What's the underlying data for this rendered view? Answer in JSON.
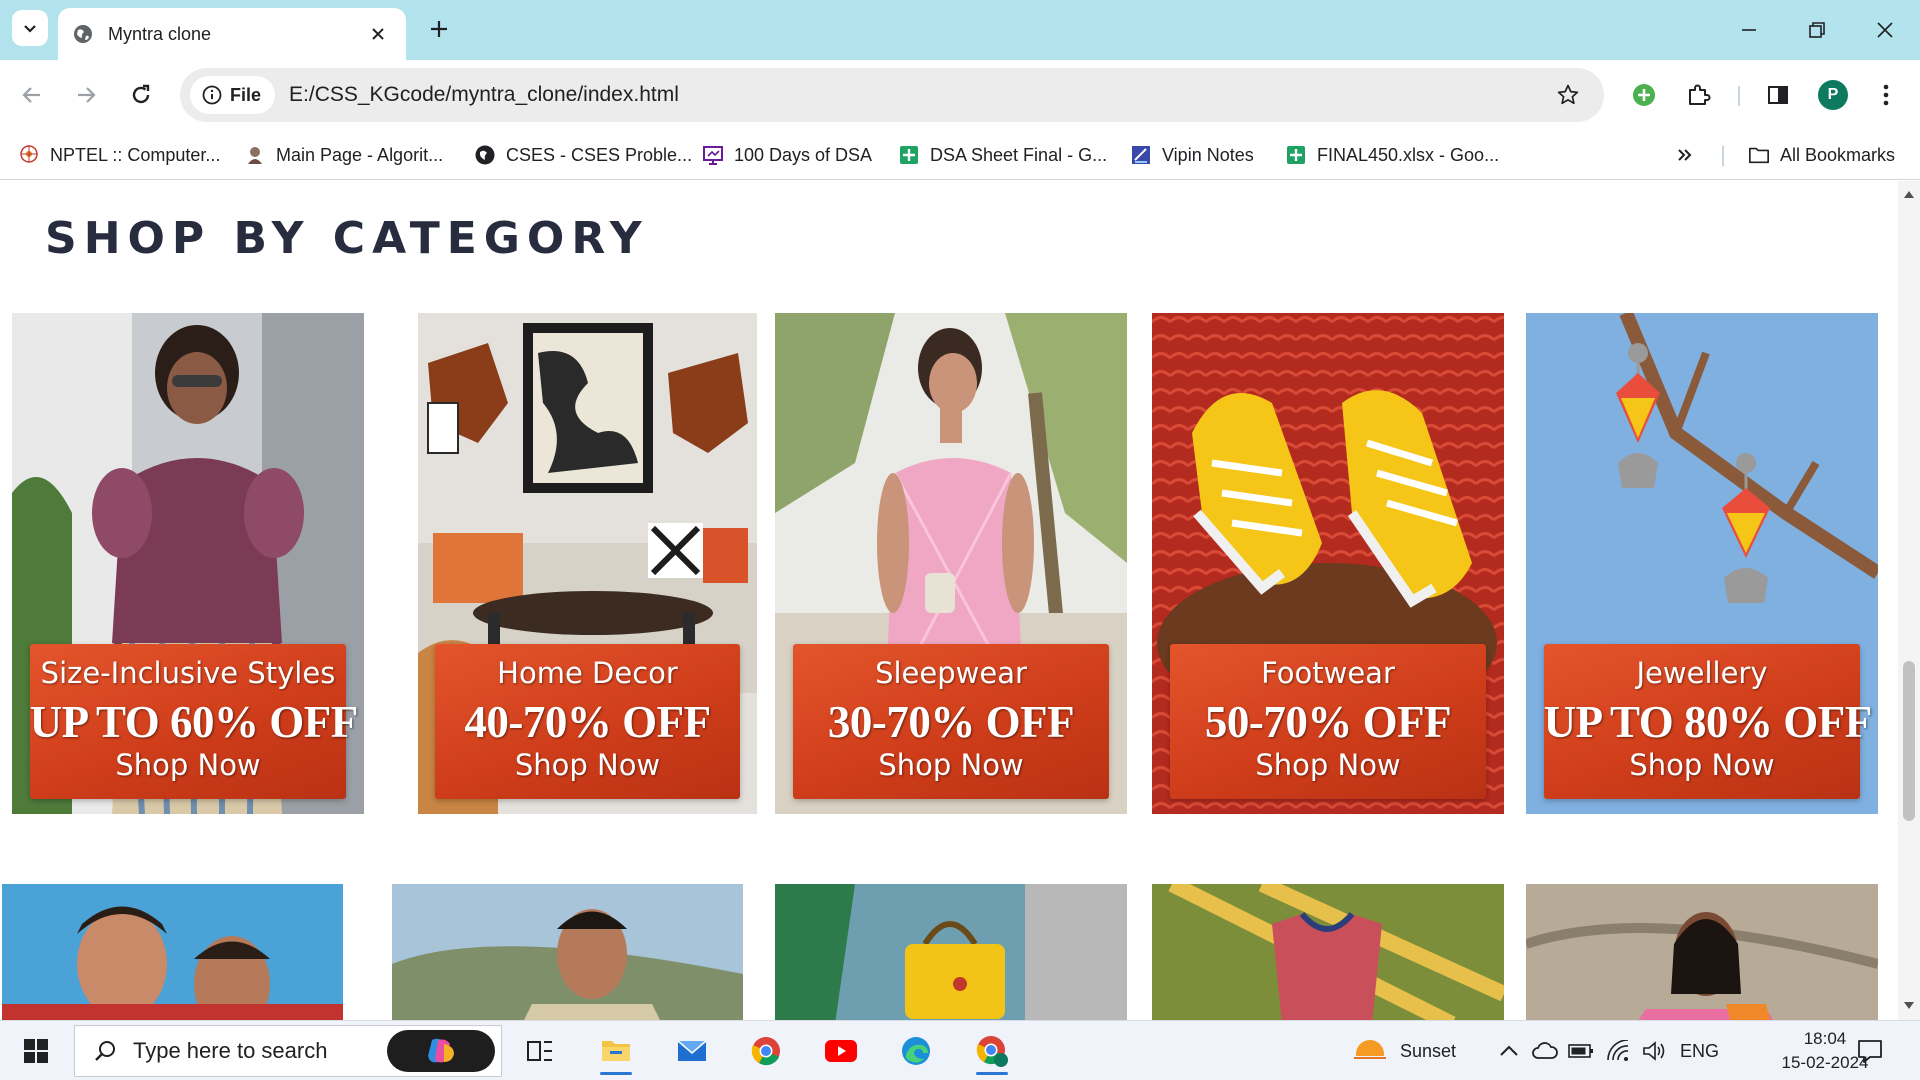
{
  "browser": {
    "tab_title": "Myntra clone",
    "site_chip_label": "File",
    "url": "E:/CSS_KGcode/myntra_clone/index.html",
    "avatar_initial": "P",
    "bookmarks": [
      {
        "label": "NPTEL :: Computer...",
        "icon": "nptel-icon"
      },
      {
        "label": "Main Page - Algorit...",
        "icon": "algorithmica-icon"
      },
      {
        "label": "CSES - CSES Proble...",
        "icon": "cses-icon"
      },
      {
        "label": "100 Days of DSA",
        "icon": "slides-icon"
      },
      {
        "label": "DSA Sheet Final - G...",
        "icon": "sheets-icon"
      },
      {
        "label": "Vipin Notes",
        "icon": "notes-icon"
      },
      {
        "label": "FINAL450.xlsx - Goo...",
        "icon": "sheets-icon"
      }
    ],
    "all_bookmarks_label": "All Bookmarks"
  },
  "page": {
    "section_title": "SHOP BY CATEGORY",
    "categories": [
      {
        "name": "Size-Inclusive Styles",
        "offer": "UP TO 60% OFF",
        "cta": "Shop Now",
        "image": "woman in mauve puff-sleeve top"
      },
      {
        "name": "Home Decor",
        "offer": "40-70% OFF",
        "cta": "Shop Now",
        "image": "living room with sofa and wall art"
      },
      {
        "name": "Sleepwear",
        "offer": "30-70% OFF",
        "cta": "Shop Now",
        "image": "woman in pink checked slip dress"
      },
      {
        "name": "Footwear",
        "offer": "50-70% OFF",
        "cta": "Shop Now",
        "image": "yellow sneakers on red wicker chair"
      },
      {
        "name": "Jewellery",
        "offer": "UP TO 80% OFF",
        "cta": "Shop Now",
        "image": "jhumka earrings hanging on branch"
      }
    ]
  },
  "taskbar": {
    "search_placeholder": "Type here to search",
    "weather": "Sunset",
    "language": "ENG",
    "time": "18:04",
    "date": "15-02-2024"
  },
  "colors": {
    "tabstrip": "#b3e3ec",
    "banner": "#d8441f",
    "title_text": "#282c3f"
  }
}
